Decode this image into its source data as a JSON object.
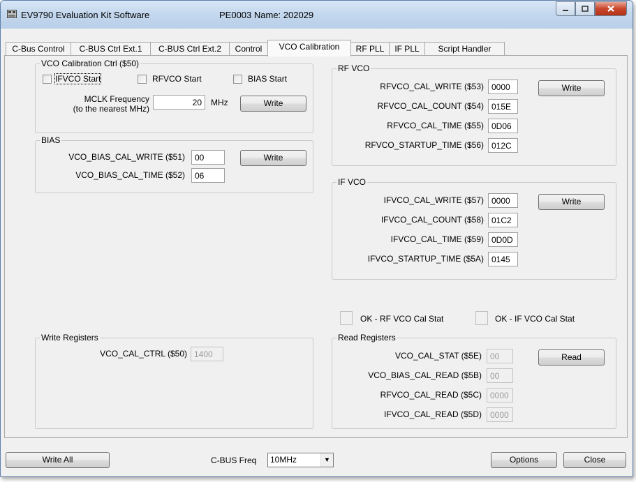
{
  "window": {
    "title": "EV9790 Evaluation Kit Software",
    "subtitle": "PE0003 Name: 202029",
    "min_icon": "minimize-icon",
    "max_icon": "maximize-icon",
    "close_icon": "close-icon"
  },
  "tabs": [
    {
      "label": "C-Bus Control"
    },
    {
      "label": "C-BUS Ctrl Ext.1"
    },
    {
      "label": "C-BUS Ctrl Ext.2"
    },
    {
      "label": "Control"
    },
    {
      "label": "VCO Calibration",
      "active": true
    },
    {
      "label": "RF PLL"
    },
    {
      "label": "IF PLL"
    },
    {
      "label": "Script Handler"
    }
  ],
  "vco_ctrl": {
    "legend": "VCO Calibration Ctrl ($50)",
    "ifvco_start": {
      "label": "IFVCO Start",
      "checked": false
    },
    "rfvco_start": {
      "label": "RFVCO Start",
      "checked": false
    },
    "bias_start": {
      "label": "BIAS Start",
      "checked": false
    },
    "mclk_label": "MCLK Frequency",
    "mclk_sub": "(to the nearest MHz)",
    "mclk_value": "20",
    "mclk_unit": "MHz",
    "write_label": "Write"
  },
  "bias": {
    "legend": "BIAS",
    "cal_write_label": "VCO_BIAS_CAL_WRITE ($51)",
    "cal_write_value": "00",
    "cal_time_label": "VCO_BIAS_CAL_TIME ($52)",
    "cal_time_value": "06",
    "write_label": "Write"
  },
  "rf_vco": {
    "legend": "RF VCO",
    "rows": [
      {
        "label": "RFVCO_CAL_WRITE ($53)",
        "value": "0000"
      },
      {
        "label": "RFVCO_CAL_COUNT ($54)",
        "value": "015E"
      },
      {
        "label": "RFVCO_CAL_TIME ($55)",
        "value": "0D06"
      },
      {
        "label": "RFVCO_STARTUP_TIME ($56)",
        "value": "012C"
      }
    ],
    "write_label": "Write"
  },
  "if_vco": {
    "legend": "IF VCO",
    "rows": [
      {
        "label": "IFVCO_CAL_WRITE ($57)",
        "value": "0000"
      },
      {
        "label": "IFVCO_CAL_COUNT ($58)",
        "value": "01C2"
      },
      {
        "label": "IFVCO_CAL_TIME ($59)",
        "value": "0D0D"
      },
      {
        "label": "IFVCO_STARTUP_TIME ($5A)",
        "value": "0145"
      }
    ],
    "write_label": "Write"
  },
  "status": {
    "rf_ok": "OK - RF VCO Cal Stat",
    "if_ok": "OK - IF VCO Cal Stat"
  },
  "write_registers": {
    "legend": "Write Registers",
    "ctrl_label": "VCO_CAL_CTRL ($50)",
    "ctrl_value": "1400"
  },
  "read_registers": {
    "legend": "Read Registers",
    "rows": [
      {
        "label": "VCO_CAL_STAT ($5E)",
        "value": "00"
      },
      {
        "label": "VCO_BIAS_CAL_READ ($5B)",
        "value": "00"
      },
      {
        "label": "RFVCO_CAL_READ ($5C)",
        "value": "0000"
      },
      {
        "label": "IFVCO_CAL_READ ($5D)",
        "value": "0000"
      }
    ],
    "read_label": "Read"
  },
  "footer": {
    "write_all": "Write All",
    "cbus_freq_label": "C-BUS Freq",
    "cbus_freq_value": "10MHz",
    "options": "Options",
    "close": "Close"
  }
}
